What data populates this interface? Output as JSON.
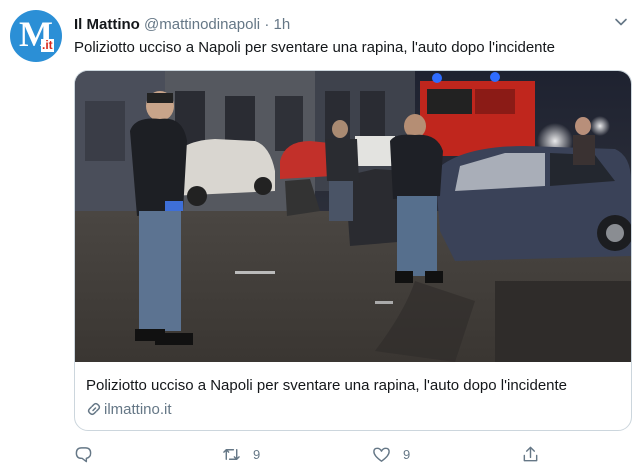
{
  "tweet": {
    "avatar": {
      "logo_letter": "M",
      "logo_suffix": ".it",
      "icon": "ilmattino-logo"
    },
    "author_name": "Il Mattino",
    "author_handle": "@mattinodinapoli",
    "separator": "·",
    "timestamp": "1h",
    "text": "Poliziotto ucciso a Napoli per sventare una rapina, l'auto dopo l'incidente",
    "card": {
      "image_icon": "news-photo",
      "title": "Poliziotto ucciso a Napoli per sventare una rapina, l'auto dopo l'incidente",
      "domain": "ilmattino.it",
      "link_icon": "link-icon"
    },
    "actions": {
      "reply": {
        "icon": "reply-icon",
        "count": ""
      },
      "retweet": {
        "icon": "retweet-icon",
        "count": "9"
      },
      "like": {
        "icon": "heart-icon",
        "count": "9"
      },
      "share": {
        "icon": "share-icon"
      }
    }
  },
  "colors": {
    "avatar_blue": "#2b8fd6",
    "logo_red": "#d9281c",
    "secondary_text": "#657786",
    "border": "#ccd6dd"
  }
}
